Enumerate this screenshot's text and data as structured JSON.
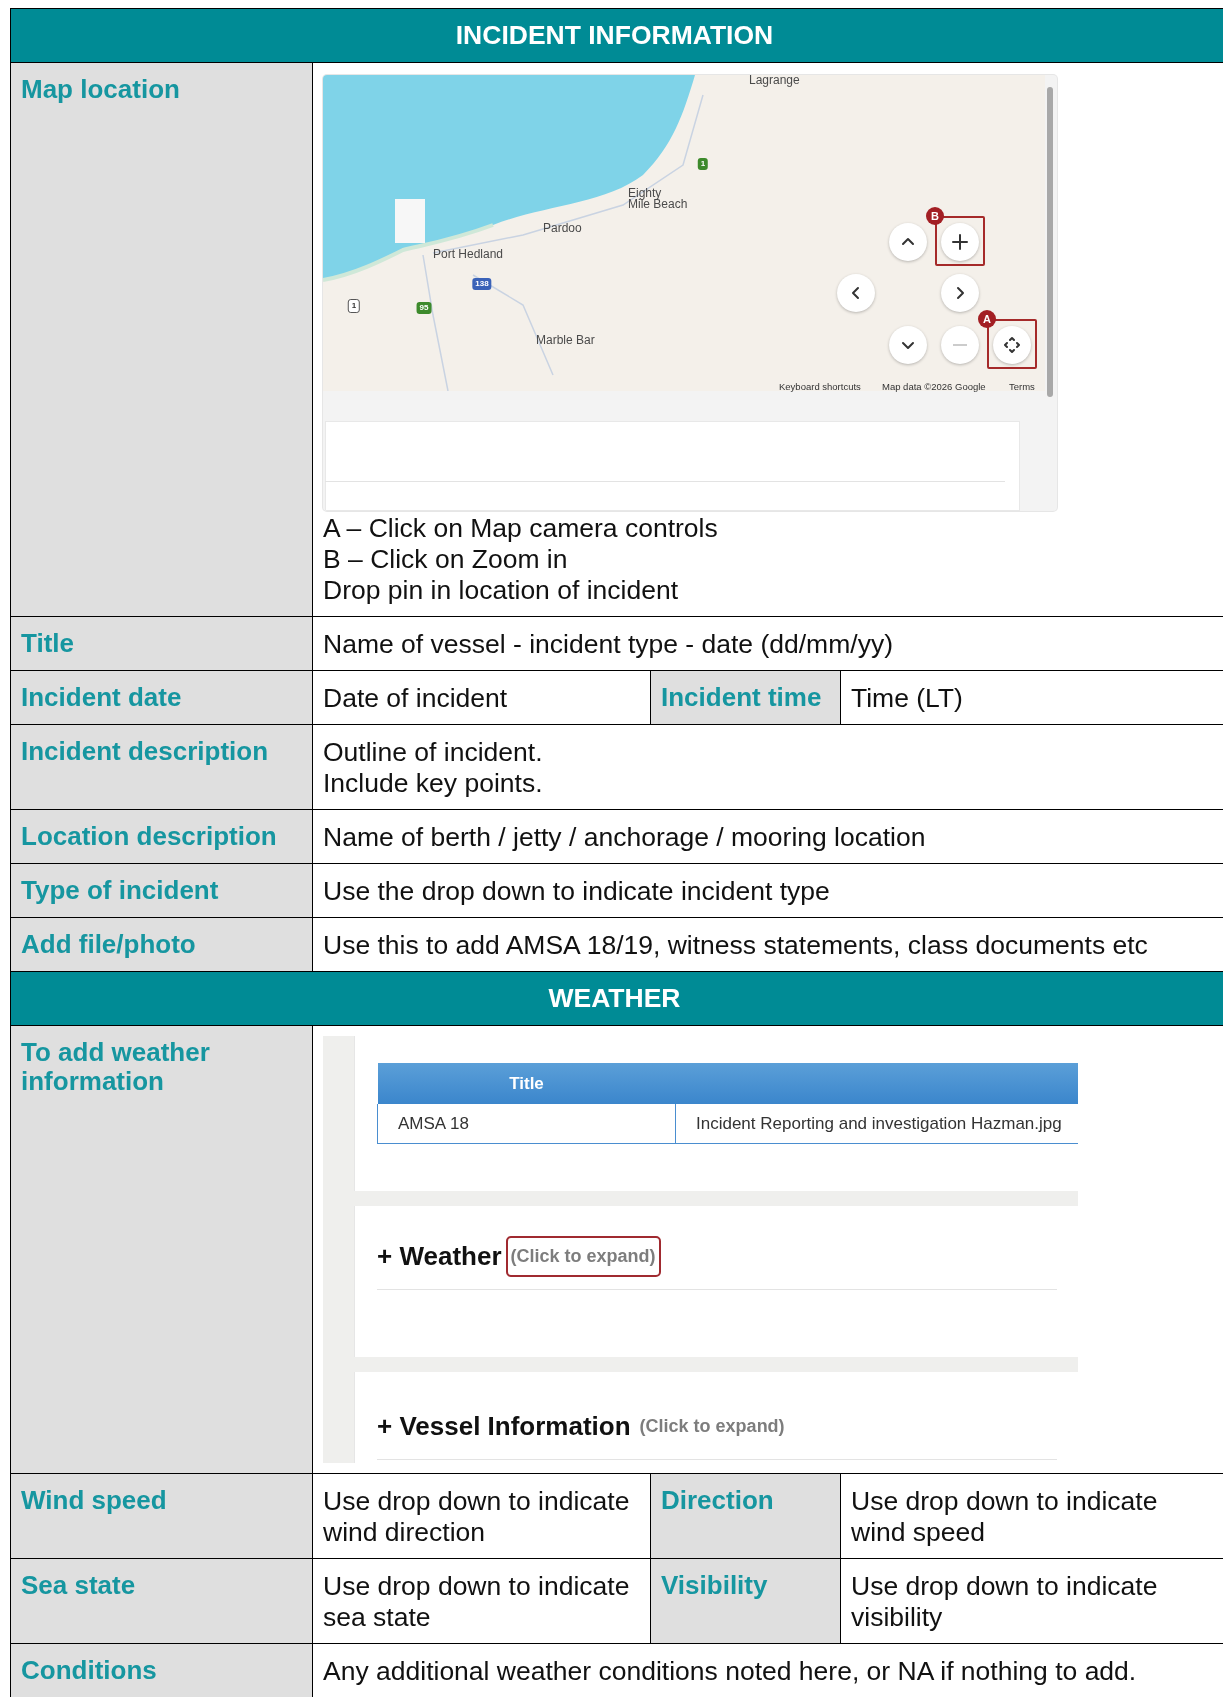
{
  "incident_section": {
    "heading": "INCIDENT INFORMATION",
    "map_row": {
      "label": "Map location",
      "map": {
        "places": [
          {
            "kind": "town",
            "name": "Lagrange"
          },
          {
            "kind": "town",
            "name": "Eighty\nMile Beach"
          },
          {
            "kind": "town",
            "name": "Pardoo"
          },
          {
            "kind": "town",
            "name": "Port Hedland"
          },
          {
            "kind": "town",
            "name": "Marble Bar"
          },
          {
            "kind": "highway",
            "name": "1"
          },
          {
            "kind": "highway",
            "name": "95"
          },
          {
            "kind": "route",
            "name": "138"
          },
          {
            "kind": "national",
            "name": "1"
          }
        ],
        "controls": [
          {
            "kind": "up"
          },
          {
            "kind": "zoom-in",
            "marker": "B"
          },
          {
            "kind": "left"
          },
          {
            "kind": "right"
          },
          {
            "kind": "down"
          },
          {
            "kind": "zoom-out"
          },
          {
            "kind": "camera",
            "marker": "A"
          }
        ],
        "footer": [
          "Keyboard shortcuts",
          "Map data ©2026 Google",
          "Terms"
        ]
      },
      "instructions": [
        "A – Click on Map camera controls",
        "B – Click on Zoom in",
        "Drop pin in location of incident"
      ]
    },
    "rows": [
      {
        "kind": "single",
        "label": "Title",
        "value": "Name of vessel - incident type - date (dd/mm/yy)"
      },
      {
        "kind": "pair",
        "label": "Incident date",
        "value": "Date of incident",
        "label_2": "Incident time",
        "value_2": "Time (LT)"
      },
      {
        "kind": "single",
        "label": "Incident description",
        "value": "Outline of incident.\nInclude key points."
      },
      {
        "kind": "single",
        "label": "Location description",
        "value": "Name of berth / jetty / anchorage / mooring location"
      },
      {
        "kind": "single",
        "label": "Type of incident",
        "value": "Use the drop down to indicate incident type"
      },
      {
        "kind": "single",
        "label": "Add file/photo",
        "value": "Use this to add AMSA 18/19, witness statements, class documents etc"
      }
    ]
  },
  "weather_section": {
    "heading": "WEATHER",
    "info_row": {
      "label": "To add weather information",
      "app": {
        "table": {
          "columns": [
            "Title"
          ],
          "rows": [
            [
              "AMSA 18",
              "Incident Reporting and investigation Hazman.jpg"
            ]
          ]
        },
        "panels": [
          {
            "title": "+ Weather",
            "hint": "(Click to expand)",
            "highlighted": true
          },
          {
            "title": "+ Vessel Information",
            "hint": "(Click to expand)",
            "highlighted": false
          }
        ]
      }
    },
    "rows": [
      {
        "kind": "pair",
        "label": "Wind speed",
        "value": "Use drop down to indicate\nwind direction",
        "label_2": "Direction",
        "value_2": "Use drop down to indicate\nwind speed"
      },
      {
        "kind": "pair",
        "label": "Sea state",
        "value": "Use drop down to indicate\nsea state",
        "label_2": "Visibility",
        "value_2": "Use drop down to indicate\nvisibility"
      },
      {
        "kind": "single",
        "label": "Conditions",
        "value": "Any additional weather conditions noted here, or NA if nothing to add."
      }
    ]
  }
}
